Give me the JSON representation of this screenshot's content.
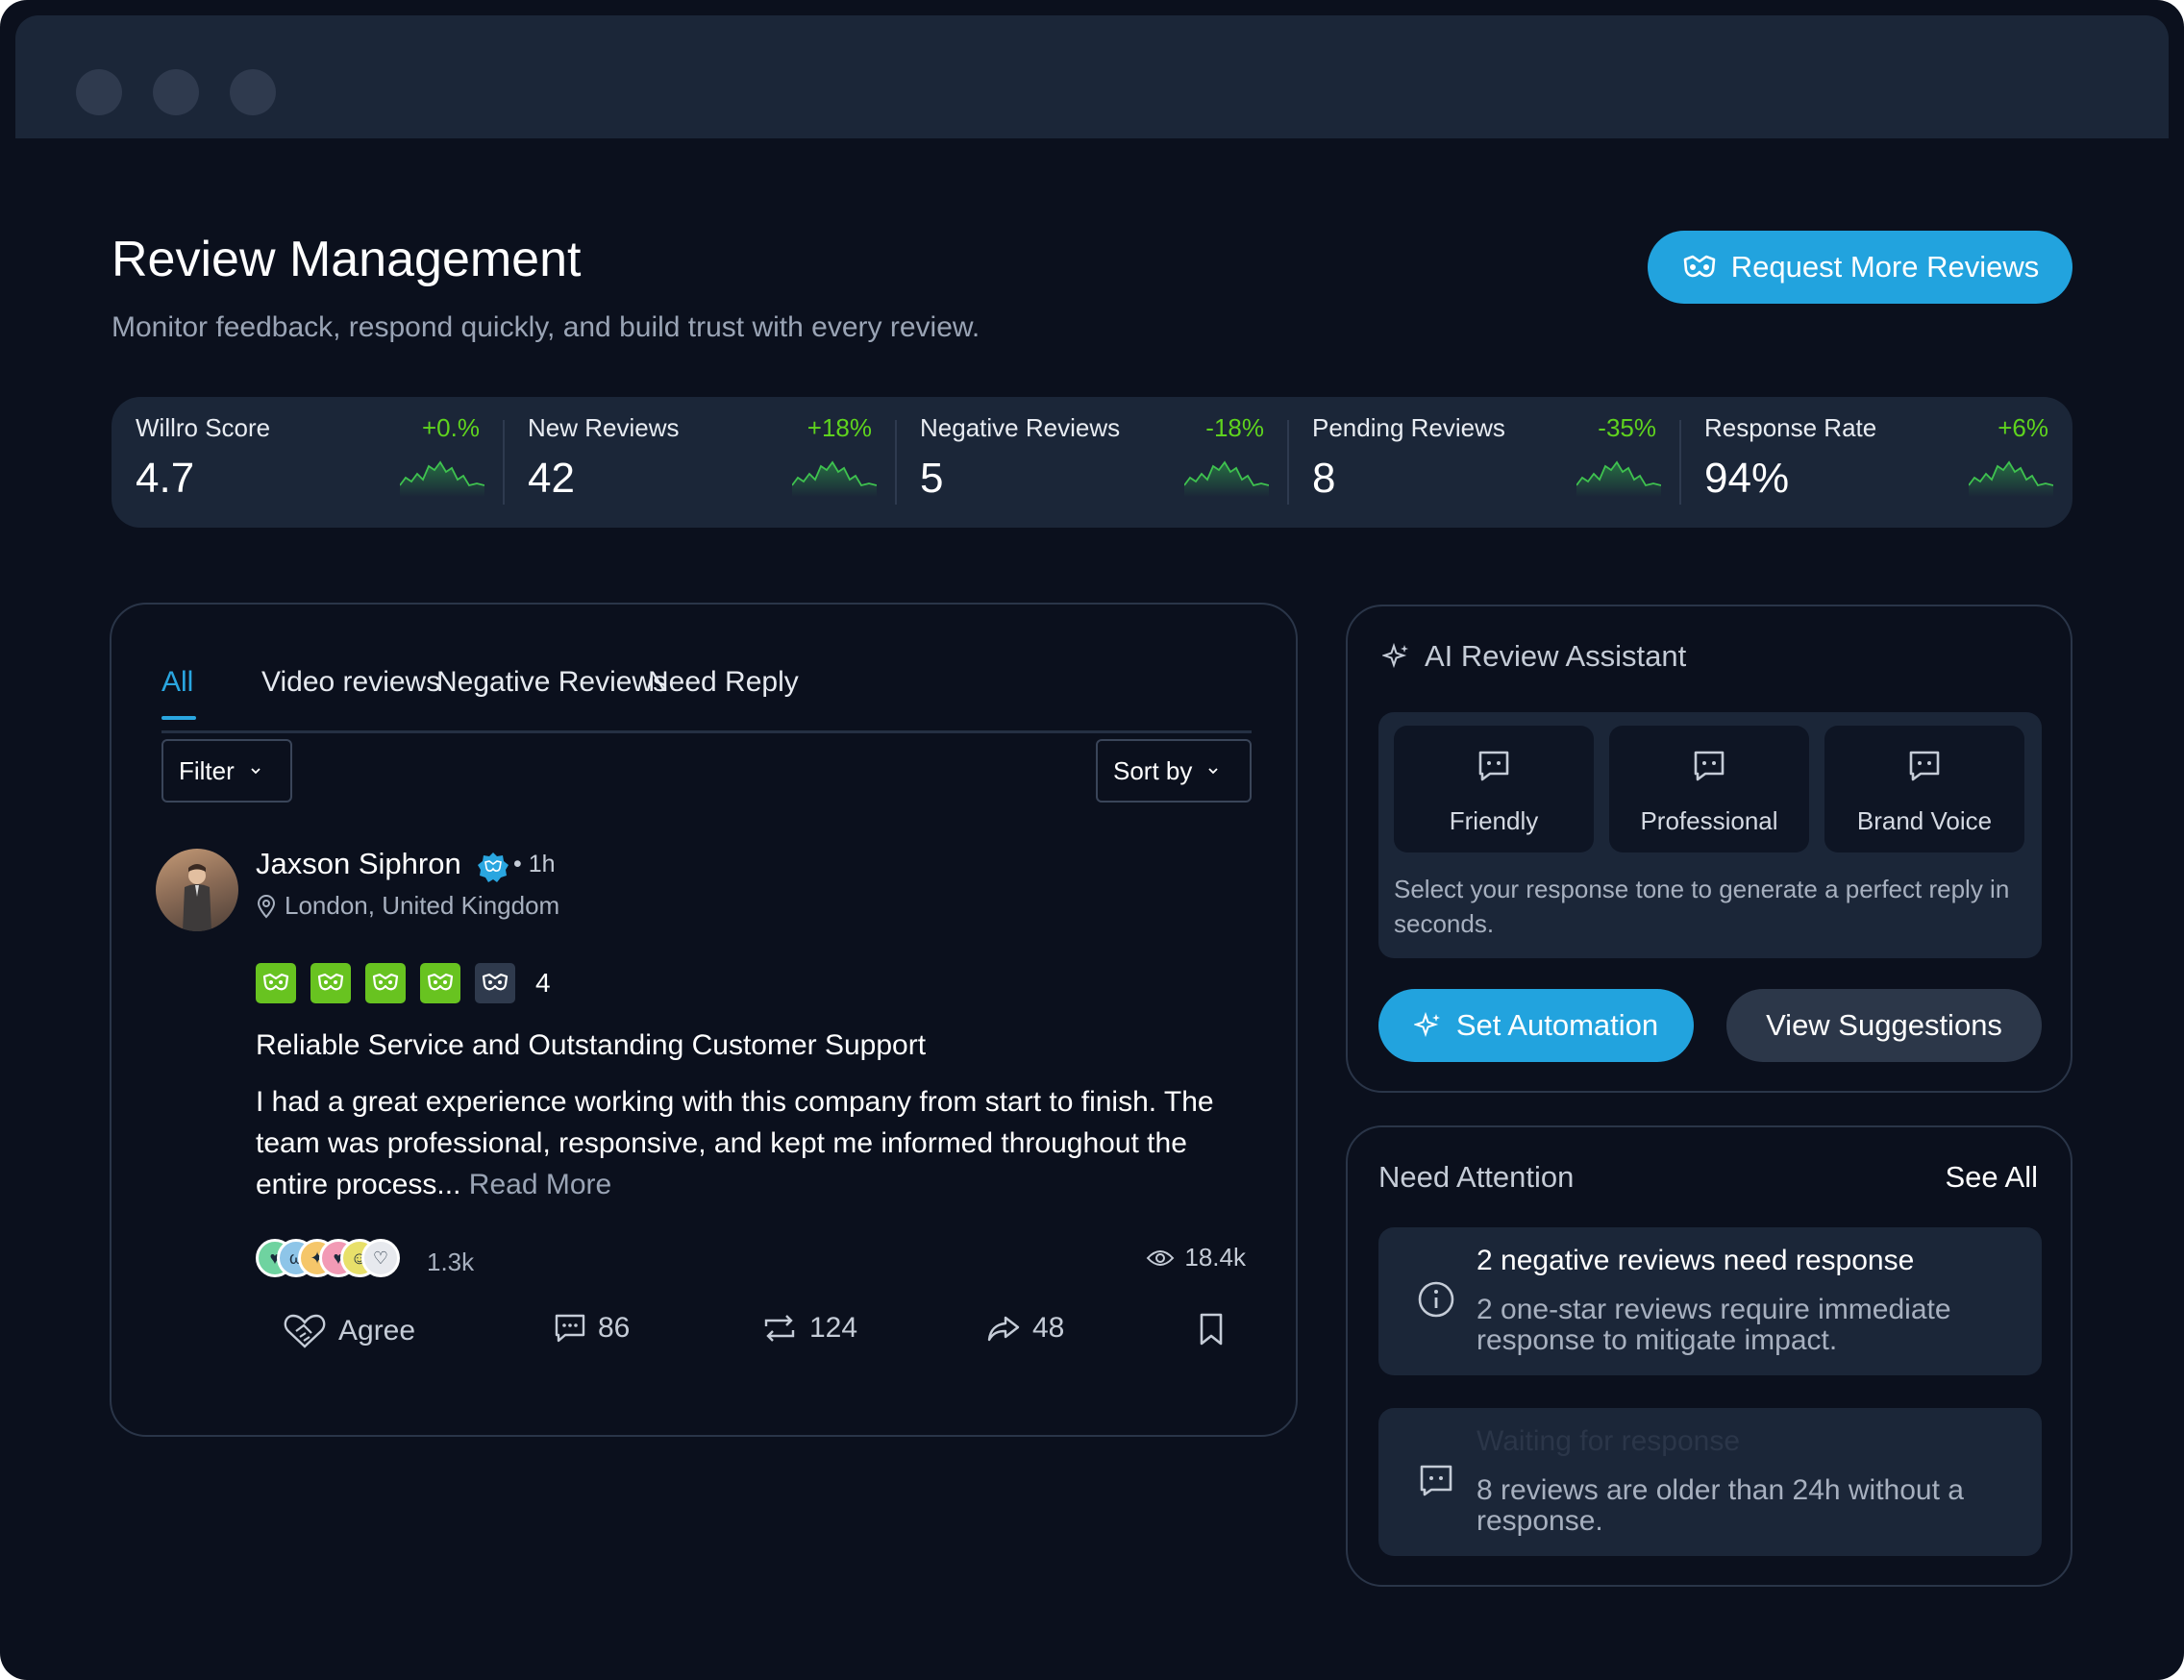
{
  "header": {
    "title": "Review Management",
    "subtitle": "Monitor feedback, respond quickly, and build trust with every review.",
    "request_button": "Request More Reviews"
  },
  "stats": [
    {
      "label": "Willro Score",
      "value": "4.7",
      "change": "+0.%"
    },
    {
      "label": "New Reviews",
      "value": "42",
      "change": "+18%"
    },
    {
      "label": "Negative Reviews",
      "value": "5",
      "change": "-18%"
    },
    {
      "label": "Pending Reviews",
      "value": "8",
      "change": "-35%"
    },
    {
      "label": "Response Rate",
      "value": "94%",
      "change": "+6%"
    }
  ],
  "colors": {
    "accent": "#22a3de",
    "positive": "#5fd31e",
    "star": "#68c320",
    "panel": "#1b2638",
    "background": "#0b101d"
  },
  "tabs": [
    "All",
    "Video reviews",
    "Negative Reviews",
    "Need Reply"
  ],
  "filter_label": "Filter",
  "sort_label": "Sort by",
  "review": {
    "name": "Jaxson Siphron",
    "time": "• 1h",
    "location": "London, United Kingdom",
    "rating": "4",
    "filled_stars": 4,
    "total_stars": 5,
    "title": "Reliable Service and Outstanding Customer Support",
    "body": "I had a great experience working with this company from start to finish. The team was professional, responsive, and kept me informed throughout the entire process...",
    "read_more": "Read More",
    "reactions_count": "1.3k",
    "views": "18.4k",
    "agree_label": "Agree",
    "comments": "86",
    "reposts": "124",
    "shares": "48"
  },
  "ai_assistant": {
    "title": "AI Review Assistant",
    "tones": [
      "Friendly",
      "Professional",
      "Brand Voice"
    ],
    "hint": "Select your response tone to generate a perfect reply in seconds.",
    "automation_button": "Set Automation",
    "suggestions_button": "View Suggestions"
  },
  "attention": {
    "title": "Need Attention",
    "see_all": "See All",
    "items": [
      {
        "heading": "2 negative reviews need response",
        "desc": "2 one-star reviews require immediate response to mitigate impact."
      },
      {
        "heading": "Waiting for response",
        "desc": "8 reviews are older than 24h without a response."
      }
    ]
  }
}
